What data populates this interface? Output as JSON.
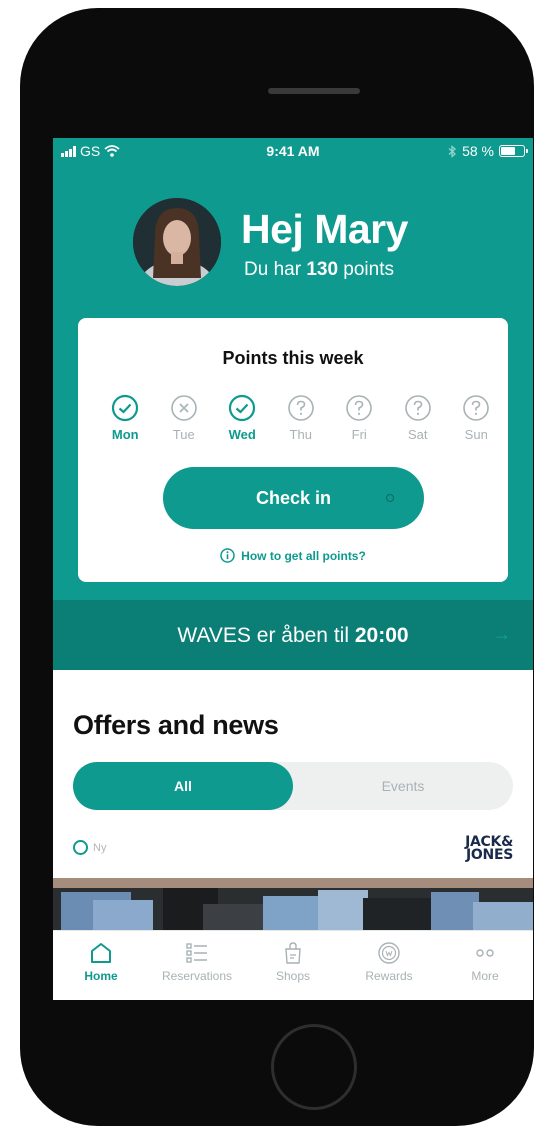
{
  "status_bar": {
    "carrier": "GS",
    "time": "9:41 AM",
    "battery": "58 %",
    "icons": [
      "signal-icon",
      "wifi-icon",
      "bluetooth-icon",
      "battery-icon"
    ]
  },
  "profile": {
    "greeting": "Hej Mary",
    "points_prefix": "Du har",
    "points_value": "130",
    "points_suffix": "points"
  },
  "points_card": {
    "title": "Points this week",
    "days": [
      {
        "label": "Mon",
        "state": "done"
      },
      {
        "label": "Tue",
        "state": "missed"
      },
      {
        "label": "Wed",
        "state": "done"
      },
      {
        "label": "Thu",
        "state": "upcoming"
      },
      {
        "label": "Fri",
        "state": "upcoming"
      },
      {
        "label": "Sat",
        "state": "upcoming"
      },
      {
        "label": "Sun",
        "state": "upcoming"
      }
    ],
    "check_in_label": "Check in",
    "how_to_label": "How to get all points?"
  },
  "banner": {
    "text": "WAVES er åben til",
    "time": "20:00"
  },
  "offers": {
    "title": "Offers and news",
    "tabs": [
      {
        "label": "All",
        "active": true
      },
      {
        "label": "Events",
        "active": false
      }
    ],
    "tag": "Ny",
    "brand_line1": "JACK&",
    "brand_line2": "JONES"
  },
  "tab_bar": {
    "items": [
      {
        "label": "Home",
        "icon": "home-icon",
        "active": true
      },
      {
        "label": "Reservations",
        "icon": "list-icon",
        "active": false
      },
      {
        "label": "Shops",
        "icon": "shopping-bag-icon",
        "active": false
      },
      {
        "label": "Rewards",
        "icon": "rewards-coin-icon",
        "active": false
      },
      {
        "label": "More",
        "icon": "more-dots-icon",
        "active": false
      }
    ]
  },
  "colors": {
    "accent": "#0e9a8e",
    "accent_dark": "#0b7f75",
    "muted": "#a9b2b5"
  }
}
